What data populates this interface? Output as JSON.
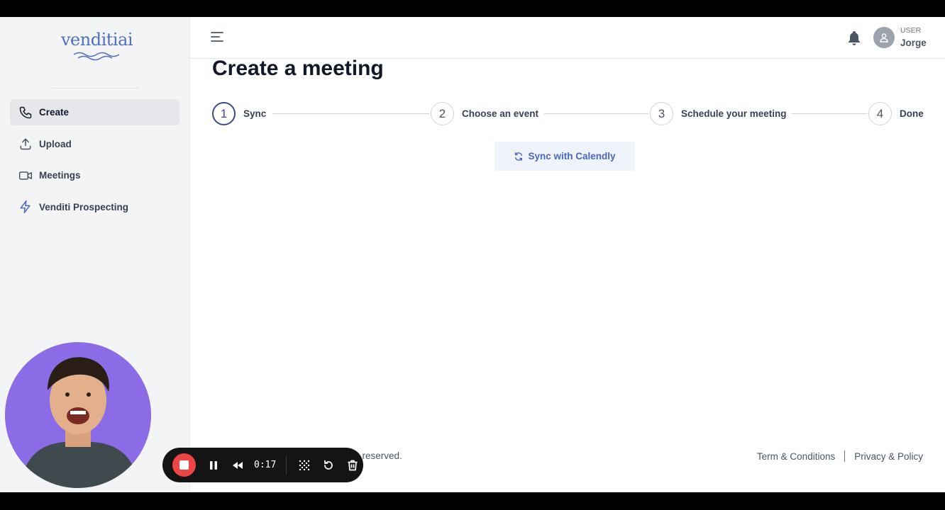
{
  "sidebar": {
    "logo_text": "venditiai",
    "items": [
      {
        "label": "Create",
        "icon": "phone-icon",
        "active": true
      },
      {
        "label": "Upload",
        "icon": "upload-icon",
        "active": false
      },
      {
        "label": "Meetings",
        "icon": "video-icon",
        "active": false
      },
      {
        "label": "Venditi Prospecting",
        "icon": "bolt-icon",
        "active": false
      }
    ]
  },
  "header": {
    "user_role": "USER",
    "user_name": "Jorge"
  },
  "main": {
    "title": "Create a meeting",
    "steps": [
      {
        "number": "1",
        "label": "Sync",
        "active": true
      },
      {
        "number": "2",
        "label": "Choose an event",
        "active": false
      },
      {
        "number": "3",
        "label": "Schedule your meeting",
        "active": false
      },
      {
        "number": "4",
        "label": "Done",
        "active": false
      }
    ],
    "sync_button_label": "Sync with Calendly"
  },
  "footer": {
    "copyright_visible": "s reserved.",
    "terms_label": "Term & Conditions",
    "privacy_label": "Privacy & Policy"
  },
  "recorder": {
    "time": "0:17"
  },
  "colors": {
    "accent": "#4868c4",
    "active_step": "#3b4a8a",
    "record": "#ef4444",
    "camera_bg": "#8c6ce6"
  }
}
